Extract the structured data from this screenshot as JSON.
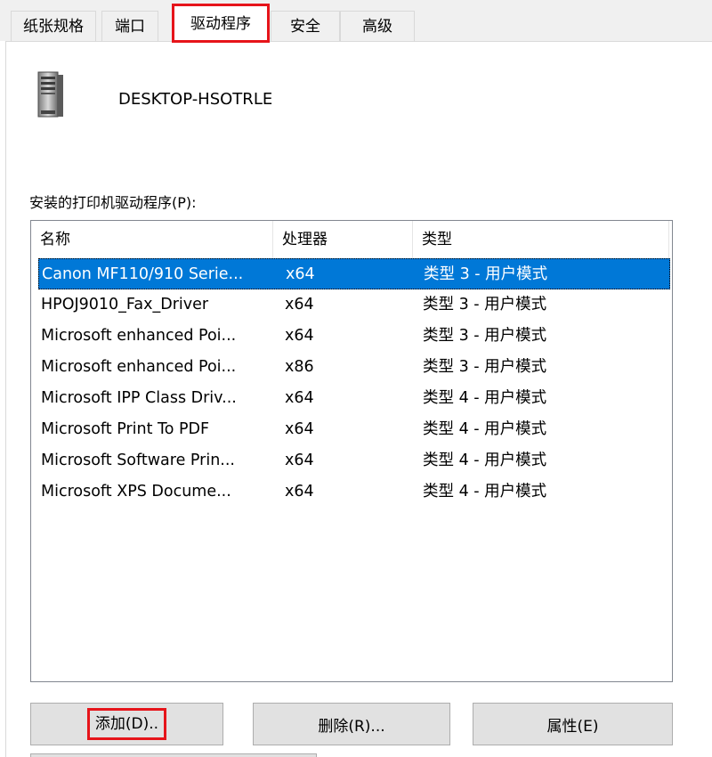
{
  "tabs": [
    "纸张规格",
    "端口",
    "驱动程序",
    "安全",
    "高级"
  ],
  "active_tab": "驱动程序",
  "server": {
    "name": "DESKTOP-HSOTRLE",
    "icon": "server-icon"
  },
  "drivers_label": "安装的打印机驱动程序(P):",
  "columns": {
    "name": "名称",
    "processor": "处理器",
    "type": "类型"
  },
  "drivers": [
    {
      "name": "Canon MF110/910 Serie...",
      "processor": "x64",
      "type": "类型 3 - 用户模式"
    },
    {
      "name": "HPOJ9010_Fax_Driver",
      "processor": "x64",
      "type": "类型 3 - 用户模式"
    },
    {
      "name": "Microsoft enhanced Poi...",
      "processor": "x64",
      "type": "类型 3 - 用户模式"
    },
    {
      "name": "Microsoft enhanced Poi...",
      "processor": "x86",
      "type": "类型 3 - 用户模式"
    },
    {
      "name": "Microsoft IPP Class Driv...",
      "processor": "x64",
      "type": "类型 4 - 用户模式"
    },
    {
      "name": "Microsoft Print To PDF",
      "processor": "x64",
      "type": "类型 4 - 用户模式"
    },
    {
      "name": "Microsoft Software Prin...",
      "processor": "x64",
      "type": "类型 4 - 用户模式"
    },
    {
      "name": "Microsoft XPS Docume...",
      "processor": "x64",
      "type": "类型 4 - 用户模式"
    }
  ],
  "buttons": {
    "add": "添加(D)..",
    "remove": "删除(R)...",
    "properties": "属性(E)"
  },
  "colors": {
    "highlight_box": "#e6141a",
    "selection": "#0078d7",
    "button_bg": "#e1e1e1"
  }
}
